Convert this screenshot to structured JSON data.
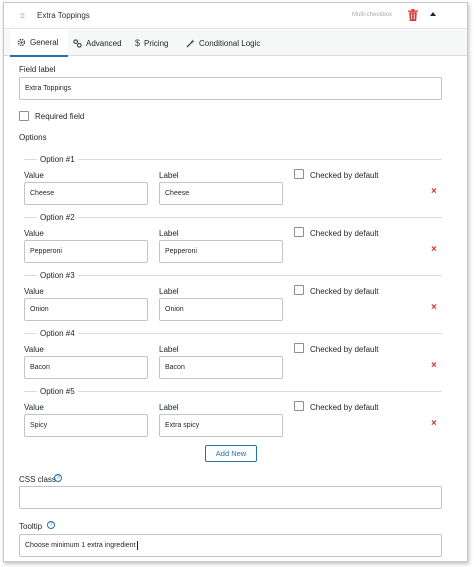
{
  "header": {
    "drag_handle": "↕↕",
    "title": "Extra Toppings",
    "field_type": "Multi-checkbox"
  },
  "tabs": [
    {
      "label": "General",
      "icon": "gear-icon"
    },
    {
      "label": "Advanced",
      "icon": "sliders-icon"
    },
    {
      "label": "Pricing",
      "icon": "dollar-icon"
    },
    {
      "label": "Conditional Logic",
      "icon": "wand-icon"
    }
  ],
  "general": {
    "field_label_label": "Field label",
    "field_label_value": "Extra Toppings",
    "required_label": "Required field",
    "options_label": "Options",
    "value_label": "Value",
    "label_label": "Label",
    "checked_label": "Checked by default",
    "options": [
      {
        "legend": "Option #1",
        "value": "Cheese",
        "label": "Cheese"
      },
      {
        "legend": "Option #2",
        "value": "Pepperoni",
        "label": "Pepperoni"
      },
      {
        "legend": "Option #3",
        "value": "Onion",
        "label": "Onion"
      },
      {
        "legend": "Option #4",
        "value": "Bacon",
        "label": "Bacon"
      },
      {
        "legend": "Option #5",
        "value": "Spicy",
        "label": "Extra spicy"
      }
    ],
    "remove_glyph": "×",
    "add_new_label": "Add New",
    "css_class_label": "CSS class",
    "css_class_value": "",
    "tooltip_label": "Tooltip",
    "tooltip_value": "Choose minimum 1 extra ingredient",
    "help_glyph": "?"
  },
  "colors": {
    "accent": "#2271b1",
    "danger": "#d63638",
    "border": "#c3c4c7"
  }
}
